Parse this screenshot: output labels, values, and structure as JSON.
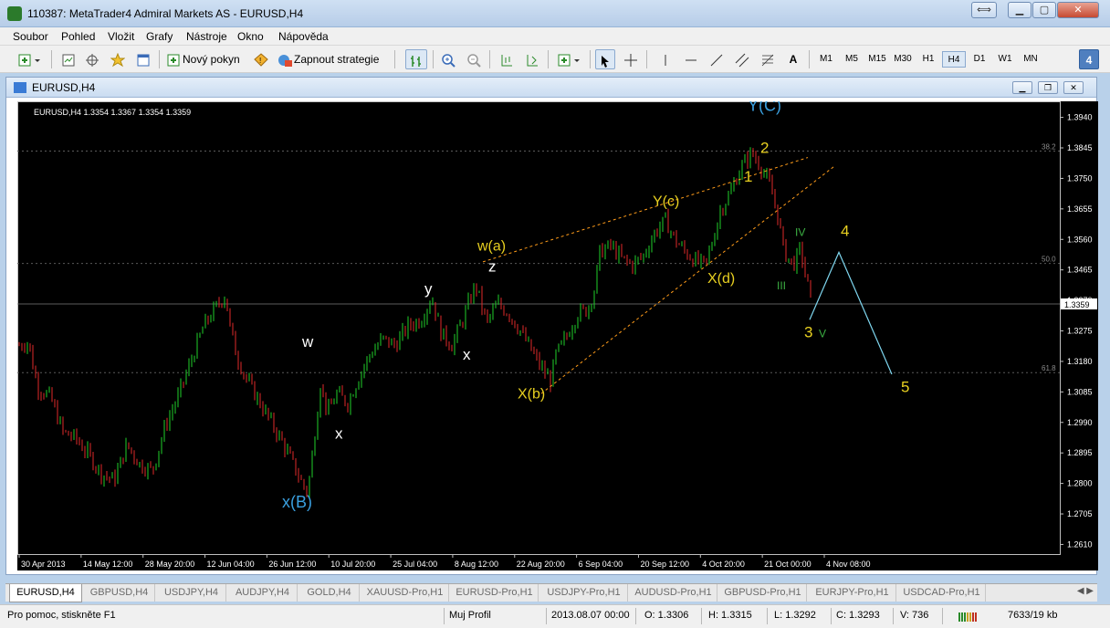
{
  "window": {
    "title": "110387: MetaTrader4 Admiral Markets AS - EURUSD,H4"
  },
  "menu": [
    "Soubor",
    "Pohled",
    "Vložit",
    "Grafy",
    "Nástroje",
    "Okno",
    "Nápověda"
  ],
  "toolbar": {
    "new_order": "Nový pokyn",
    "autotrading": "Zapnout strategie",
    "text_tool": "A",
    "timeframes": [
      "M1",
      "M5",
      "M15",
      "M30",
      "H1",
      "H4",
      "D1",
      "W1",
      "MN"
    ],
    "selected_timeframe": "H4",
    "badge": "4"
  },
  "chart_window": {
    "title": "EURUSD,H4"
  },
  "chart_data": {
    "type": "candlestick",
    "symbol_info": "EURUSD,H4  1.3354 1.3367 1.3354 1.3359",
    "current_price": "1.3359",
    "ylim": [
      1.258,
      1.399
    ],
    "y_ticks": [
      "1.3940",
      "1.3845",
      "1.3750",
      "1.3655",
      "1.3560",
      "1.3465",
      "1.3370",
      "1.3275",
      "1.3180",
      "1.3085",
      "1.2990",
      "1.2895",
      "1.2800",
      "1.2705",
      "1.2610"
    ],
    "x_ticks": [
      "30 Apr 2013",
      "14 May 12:00",
      "28 May 20:00",
      "12 Jun 04:00",
      "26 Jun 12:00",
      "10 Jul 20:00",
      "25 Jul 04:00",
      "8 Aug 12:00",
      "22 Aug 20:00",
      "6 Sep 04:00",
      "20 Sep 12:00",
      "4 Oct 20:00",
      "21 Oct 00:00",
      "4 Nov 08:00"
    ],
    "fib_levels": [
      {
        "label": "38.2",
        "value": 1.3835
      },
      {
        "label": "50.0",
        "value": 1.3485
      },
      {
        "label": "61.8",
        "value": 1.3145
      }
    ],
    "price_path": [
      [
        0,
        1.323
      ],
      [
        10,
        1.324
      ],
      [
        20,
        1.31
      ],
      [
        34,
        1.307
      ],
      [
        48,
        1.296
      ],
      [
        62,
        1.294
      ],
      [
        76,
        1.289
      ],
      [
        90,
        1.283
      ],
      [
        104,
        1.281
      ],
      [
        118,
        1.292
      ],
      [
        132,
        1.286
      ],
      [
        146,
        1.284
      ],
      [
        160,
        1.298
      ],
      [
        174,
        1.307
      ],
      [
        188,
        1.318
      ],
      [
        202,
        1.329
      ],
      [
        216,
        1.335
      ],
      [
        226,
        1.339
      ],
      [
        230,
        1.33
      ],
      [
        238,
        1.32
      ],
      [
        248,
        1.313
      ],
      [
        262,
        1.306
      ],
      [
        276,
        1.299
      ],
      [
        290,
        1.292
      ],
      [
        300,
        1.286
      ],
      [
        310,
        1.28
      ],
      [
        316,
        1.277
      ],
      [
        322,
        1.291
      ],
      [
        330,
        1.311
      ],
      [
        338,
        1.302
      ],
      [
        348,
        1.308
      ],
      [
        360,
        1.305
      ],
      [
        372,
        1.313
      ],
      [
        384,
        1.32
      ],
      [
        398,
        1.325
      ],
      [
        412,
        1.323
      ],
      [
        426,
        1.329
      ],
      [
        440,
        1.331
      ],
      [
        452,
        1.338
      ],
      [
        462,
        1.327
      ],
      [
        474,
        1.323
      ],
      [
        486,
        1.331
      ],
      [
        500,
        1.342
      ],
      [
        512,
        1.33
      ],
      [
        524,
        1.336
      ],
      [
        536,
        1.333
      ],
      [
        548,
        1.328
      ],
      [
        560,
        1.322
      ],
      [
        572,
        1.316
      ],
      [
        582,
        1.312
      ],
      [
        588,
        1.32
      ],
      [
        600,
        1.326
      ],
      [
        612,
        1.333
      ],
      [
        622,
        1.334
      ],
      [
        630,
        1.34
      ],
      [
        636,
        1.352
      ],
      [
        648,
        1.354
      ],
      [
        660,
        1.35
      ],
      [
        672,
        1.348
      ],
      [
        684,
        1.351
      ],
      [
        696,
        1.358
      ],
      [
        708,
        1.362
      ],
      [
        718,
        1.356
      ],
      [
        730,
        1.352
      ],
      [
        742,
        1.349
      ],
      [
        752,
        1.348
      ],
      [
        760,
        1.356
      ],
      [
        768,
        1.365
      ],
      [
        778,
        1.37
      ],
      [
        790,
        1.378
      ],
      [
        802,
        1.383
      ],
      [
        812,
        1.379
      ],
      [
        822,
        1.373
      ],
      [
        830,
        1.365
      ],
      [
        838,
        1.352
      ],
      [
        848,
        1.348
      ],
      [
        856,
        1.353
      ],
      [
        862,
        1.344
      ],
      [
        868,
        1.3359
      ]
    ],
    "projection": [
      [
        868,
        1.331
      ],
      [
        900,
        1.352
      ],
      [
        958,
        1.314
      ]
    ],
    "trendlines": [
      {
        "from": [
          510,
          1.349
        ],
        "to": [
          866,
          1.3815
        ]
      },
      {
        "from": [
          574,
          1.308
        ],
        "to": [
          896,
          1.379
        ]
      }
    ],
    "wave_labels": [
      {
        "text": "Y(C)",
        "x": 800,
        "y": 1.396,
        "color": "#3aa0e0"
      },
      {
        "text": "2",
        "x": 814,
        "y": 1.383,
        "color": "#e8d020"
      },
      {
        "text": "1",
        "x": 796,
        "y": 1.374,
        "color": "#e8d020"
      },
      {
        "text": "Y(c)",
        "x": 696,
        "y": 1.3665,
        "color": "#e8d020"
      },
      {
        "text": "IV",
        "x": 852,
        "y": 1.357,
        "color": "#3cb043"
      },
      {
        "text": "4",
        "x": 902,
        "y": 1.357,
        "color": "#e8d020"
      },
      {
        "text": "w(a)",
        "x": 504,
        "y": 1.3525,
        "color": "#e8d020"
      },
      {
        "text": "z",
        "x": 516,
        "y": 1.346,
        "color": "#ffffff"
      },
      {
        "text": "X(d)",
        "x": 756,
        "y": 1.3425,
        "color": "#e8d020"
      },
      {
        "text": "III",
        "x": 832,
        "y": 1.3405,
        "color": "#3cb043"
      },
      {
        "text": "y",
        "x": 446,
        "y": 1.339,
        "color": "#ffffff"
      },
      {
        "text": "3",
        "x": 862,
        "y": 1.3255,
        "color": "#e8d020"
      },
      {
        "text": "V",
        "x": 878,
        "y": 1.3255,
        "color": "#3cb043"
      },
      {
        "text": "w",
        "x": 312,
        "y": 1.3225,
        "color": "#ffffff"
      },
      {
        "text": "x",
        "x": 488,
        "y": 1.3185,
        "color": "#ffffff"
      },
      {
        "text": "X(b)",
        "x": 548,
        "y": 1.3065,
        "color": "#e8d020"
      },
      {
        "text": "5",
        "x": 968,
        "y": 1.3085,
        "color": "#e8d020"
      },
      {
        "text": "x",
        "x": 348,
        "y": 1.294,
        "color": "#ffffff"
      },
      {
        "text": "x(B)",
        "x": 290,
        "y": 1.2725,
        "color": "#3aa0e0"
      }
    ]
  },
  "tabs": [
    "EURUSD,H4",
    "GBPUSD,H4",
    "USDJPY,H4",
    "AUDJPY,H4",
    "GOLD,H4",
    "XAUUSD-Pro,H1",
    "EURUSD-Pro,H1",
    "USDJPY-Pro,H1",
    "AUDUSD-Pro,H1",
    "GBPUSD-Pro,H1",
    "EURJPY-Pro,H1",
    "USDCAD-Pro,H1"
  ],
  "status": {
    "help": "Pro pomoc, stiskněte F1",
    "profile": "Muj Profil",
    "datetime": "2013.08.07 00:00",
    "open": "O: 1.3306",
    "high": "H: 1.3315",
    "low": "L: 1.3292",
    "close": "C: 1.3293",
    "volume": "V: 736",
    "traffic": "7633/19 kb"
  }
}
